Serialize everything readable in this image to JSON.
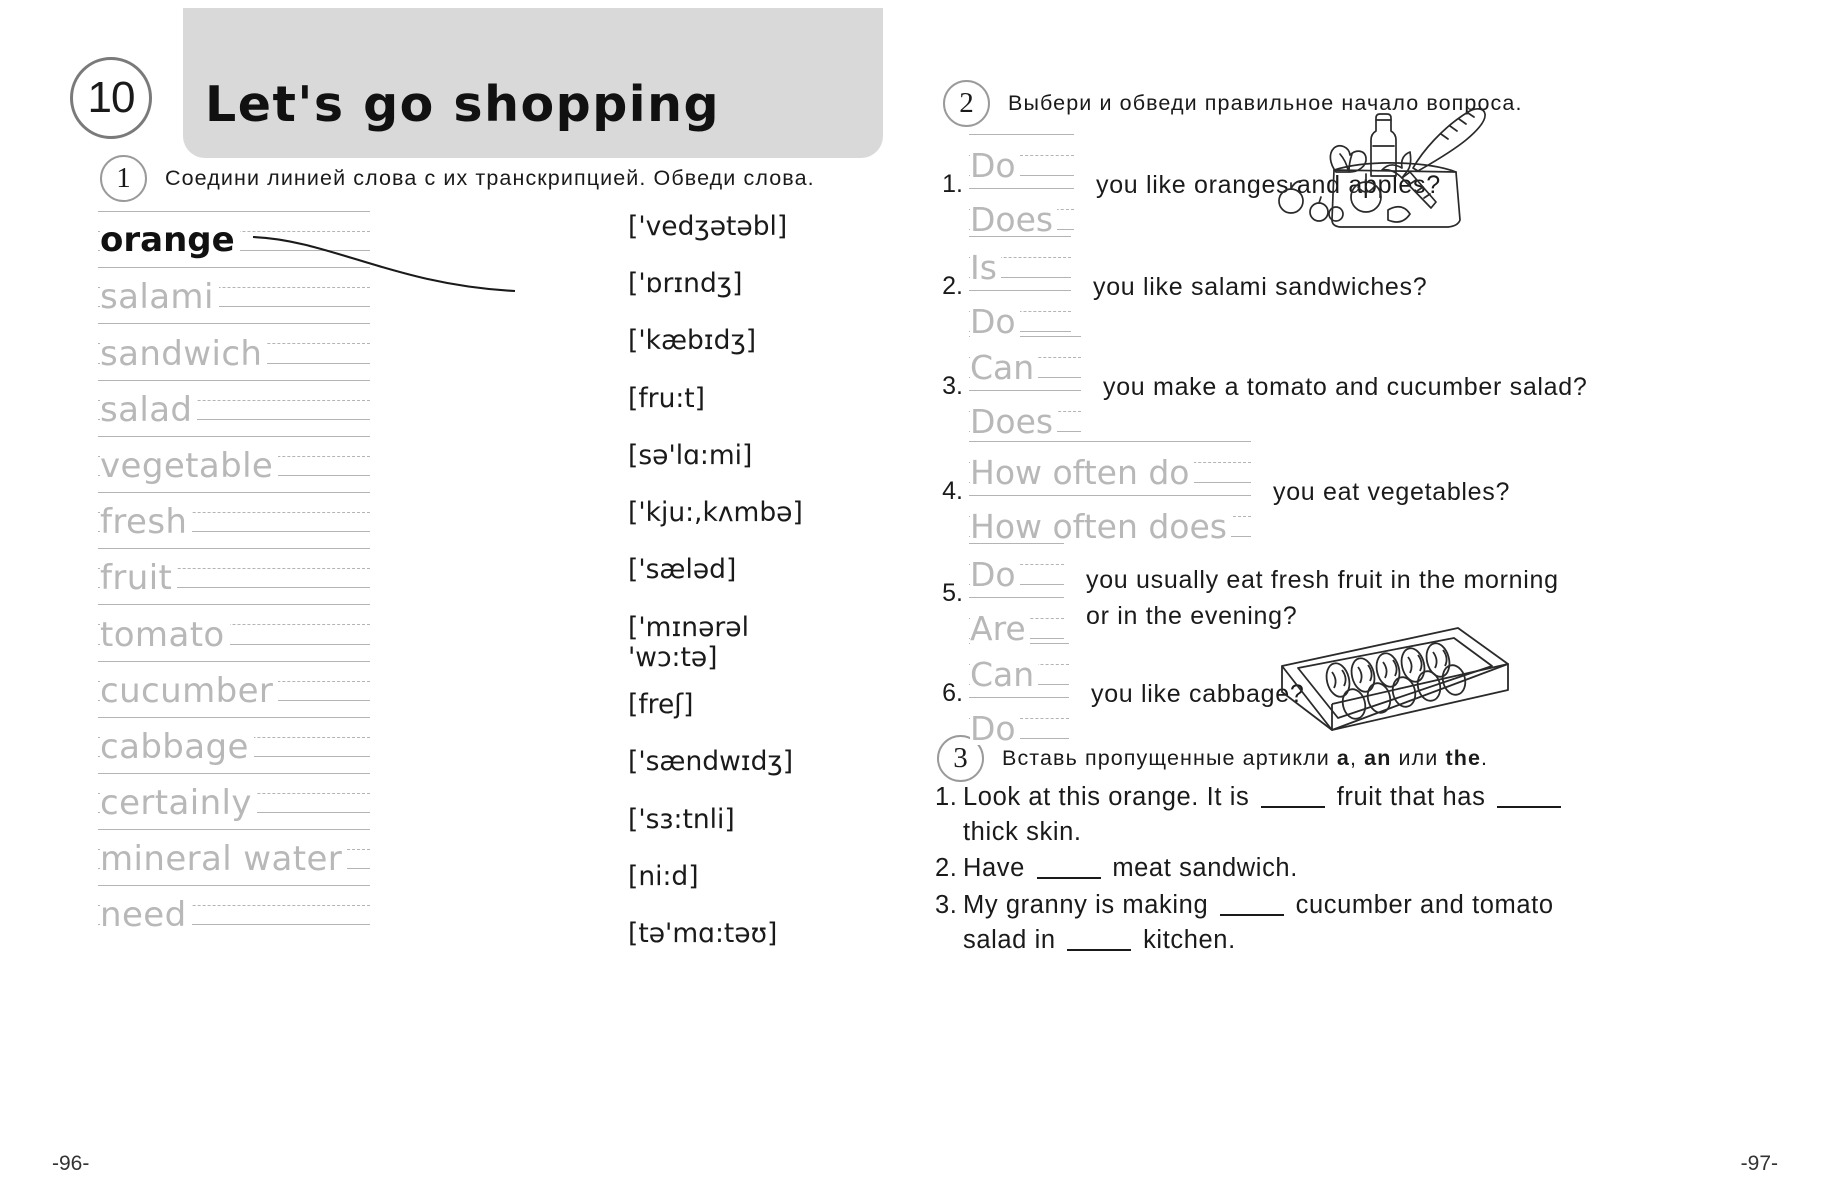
{
  "unit": {
    "number": "10",
    "title": "Let's go shopping"
  },
  "pages": {
    "left": "-96-",
    "right": "-97-"
  },
  "exercise1": {
    "number": "1",
    "instruction": "Соедини линией слова с их транскрипцией. Обведи слова.",
    "words": [
      {
        "text": "orange",
        "style": "solid"
      },
      {
        "text": "salami",
        "style": "trace"
      },
      {
        "text": "sandwich",
        "style": "trace"
      },
      {
        "text": "salad",
        "style": "trace"
      },
      {
        "text": "vegetable",
        "style": "trace"
      },
      {
        "text": "fresh",
        "style": "trace"
      },
      {
        "text": "fruit",
        "style": "trace"
      },
      {
        "text": "tomato",
        "style": "trace"
      },
      {
        "text": "cucumber",
        "style": "trace"
      },
      {
        "text": "cabbage",
        "style": "trace"
      },
      {
        "text": "certainly",
        "style": "trace"
      },
      {
        "text": "mineral water",
        "style": "trace"
      },
      {
        "text": "need",
        "style": "trace"
      }
    ],
    "transcriptions": [
      {
        "line1": "['vedʒətəbl]",
        "line2": ""
      },
      {
        "line1": "['ɒrɪndʒ]",
        "line2": ""
      },
      {
        "line1": "['kæbɪdʒ]",
        "line2": ""
      },
      {
        "line1": "[fru:t]",
        "line2": ""
      },
      {
        "line1": "[sə'lɑ:mi]",
        "line2": ""
      },
      {
        "line1": "['kju:,kʌmbə]",
        "line2": ""
      },
      {
        "line1": "['sæləd]",
        "line2": ""
      },
      {
        "line1": "['mɪnərəl",
        "line2": "'wɔ:tə]"
      },
      {
        "line1": "[freʃ]",
        "line2": ""
      },
      {
        "line1": "['sændwɪdʒ]",
        "line2": ""
      },
      {
        "line1": "['sɜ:tnli]",
        "line2": ""
      },
      {
        "line1": "[ni:d]",
        "line2": ""
      },
      {
        "line1": "[tə'mɑ:təʊ]",
        "line2": ""
      }
    ]
  },
  "exercise2": {
    "number": "2",
    "instruction": "Выбери и обведи правильное начало вопроса.",
    "questions": [
      {
        "num": "1.",
        "option_a": "Do",
        "option_b": "Does",
        "text": "you like oranges and apples?",
        "text2": ""
      },
      {
        "num": "2.",
        "option_a": "Is",
        "option_b": "Do",
        "text": "you like salami sandwiches?",
        "text2": ""
      },
      {
        "num": "3.",
        "option_a": "Can",
        "option_b": "Does",
        "text": "you make a tomato and cucumber salad?",
        "text2": ""
      },
      {
        "num": "4.",
        "option_a": "How often do",
        "option_b": "How often does",
        "text": "you eat vegetables?",
        "text2": ""
      },
      {
        "num": "5.",
        "option_a": "Do",
        "option_b": "Are",
        "text": "you usually eat fresh fruit in the morning",
        "text2": "or in the evening?"
      },
      {
        "num": "6.",
        "option_a": "Can",
        "option_b": "Do",
        "text": "you like cabbage?",
        "text2": ""
      }
    ]
  },
  "exercise3": {
    "number": "3",
    "instruction_a": "Вставь пропущенные артикли",
    "article_a": "a",
    "article_comma": ",",
    "article_an": "an",
    "instruction_b": "или",
    "article_the": "the",
    "instruction_end": ".",
    "items": [
      {
        "num": "1.",
        "parts": [
          "Look at this orange. It is",
          "fruit that has",
          "thick skin."
        ]
      },
      {
        "num": "2.",
        "parts": [
          "Have",
          "meat sandwich."
        ]
      },
      {
        "num": "3.",
        "parts": [
          "My granny is making",
          "cucumber and tomato salad in",
          "kitchen."
        ]
      }
    ]
  },
  "illustrations": [
    {
      "name": "grocery-bag-illustration"
    },
    {
      "name": "chocolate-box-illustration"
    }
  ],
  "colors": {
    "band": "#d9d9d9",
    "trace_gray": "#b8b8b8",
    "rule_gray": "#b4b4b4",
    "ink": "#1a1a1a"
  }
}
